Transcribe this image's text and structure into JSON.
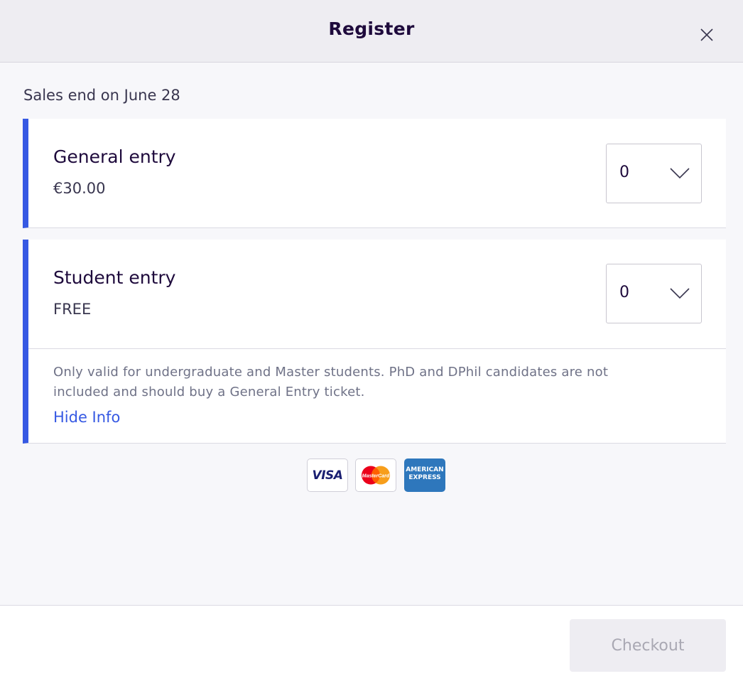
{
  "header": {
    "title": "Register",
    "close_icon": "close-icon"
  },
  "sales_end": "Sales end on June 28",
  "tickets": [
    {
      "name": "General entry",
      "price": "€30.00",
      "quantity": "0",
      "chevron_icon": "chevron-down-icon"
    },
    {
      "name": "Student entry",
      "price": "FREE",
      "quantity": "0",
      "chevron_icon": "chevron-down-icon",
      "info_line1": "Only valid for undergraduate and Master students. PhD and DPhil candidates are not",
      "info_line2": "included and should buy a General Entry ticket.",
      "hide_info_label": "Hide Info"
    }
  ],
  "payment_cards": {
    "visa_text": "VISA",
    "mastercard_text": "MasterCard",
    "amex_line1": "AMERICAN",
    "amex_line2": "EXPRESS"
  },
  "footer": {
    "checkout_label": "Checkout",
    "checkout_enabled": false
  },
  "colors": {
    "accent": "#3659e3",
    "text_primary": "#1e0a3c",
    "text_secondary": "#6f7287",
    "header_bg": "#eeedf2",
    "page_bg": "#f7f7fa",
    "amex_blue": "#2e77bc",
    "mc_red": "#eb001b",
    "mc_yellow": "#f79e1b"
  }
}
